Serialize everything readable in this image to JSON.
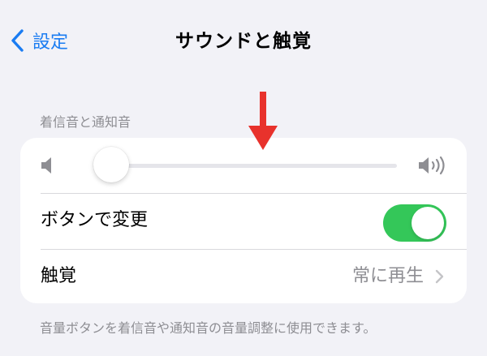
{
  "nav": {
    "back_label": "設定",
    "title": "サウンドと触覚"
  },
  "section": {
    "header": "着信音と通知音",
    "footer": "音量ボタンを着信音や通知音の音量調整に使用できます。"
  },
  "volume": {
    "level": 0.0,
    "low_icon": "speaker-low-icon",
    "high_icon": "speaker-high-icon"
  },
  "change_with_buttons": {
    "label": "ボタンで変更",
    "enabled": true
  },
  "haptics": {
    "label": "触覚",
    "value": "常に再生"
  },
  "colors": {
    "accent": "#1a7cf2",
    "toggle_on": "#34c759",
    "annotation": "#e8322c"
  }
}
